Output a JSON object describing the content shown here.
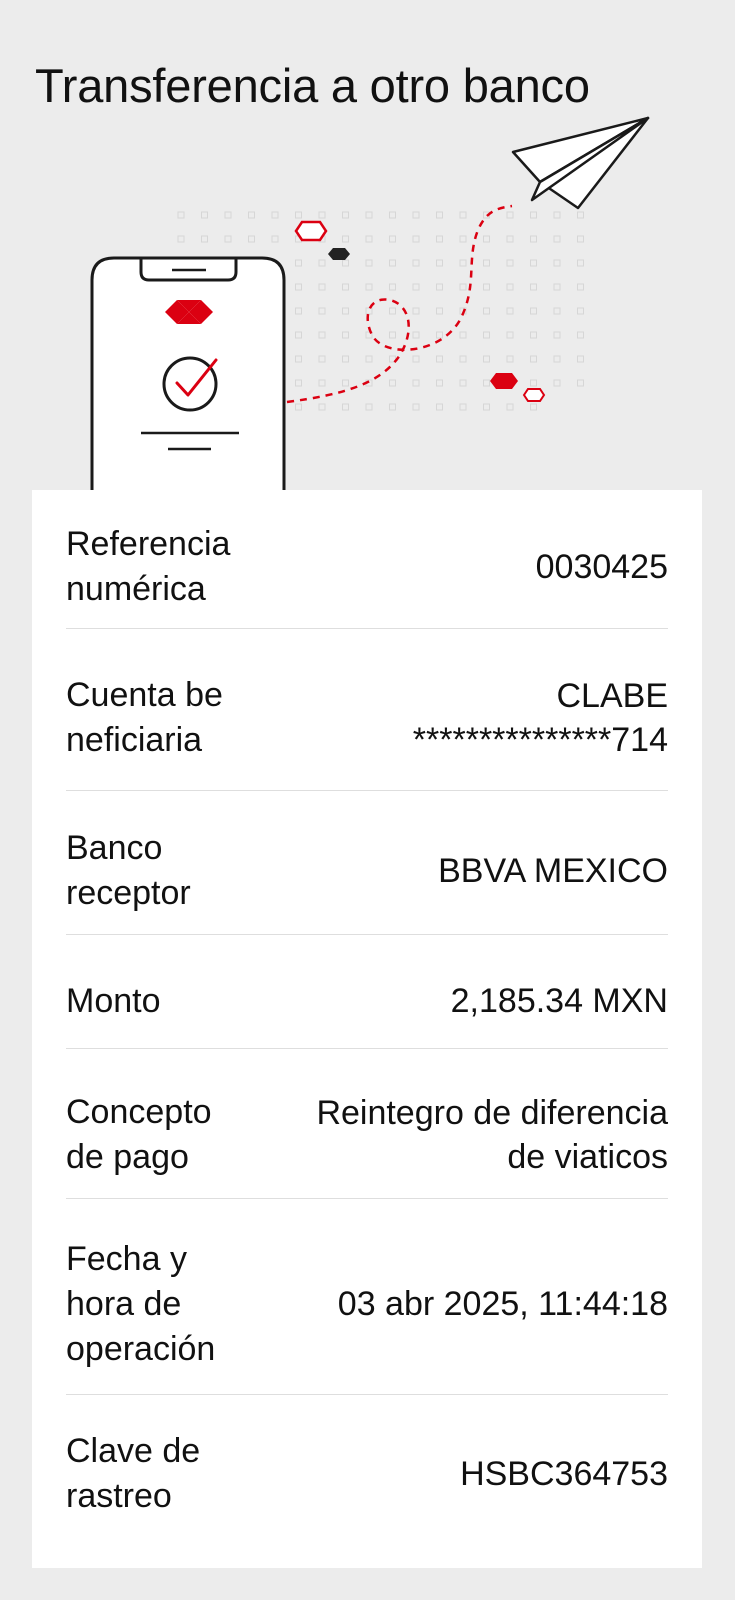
{
  "title": "Transferencia a otro banco",
  "icons": [
    "paper-plane-icon",
    "hsbc-logo-icon",
    "check-circle-icon"
  ],
  "colors": {
    "accent": "#db0011",
    "background": "#ececec",
    "card": "#ffffff",
    "text": "#111111"
  },
  "details": [
    {
      "label": "Referencia\nnumérica",
      "value": "0030425"
    },
    {
      "label": "Cuenta be\nneficiaria",
      "value": "CLABE\n***************714"
    },
    {
      "label": "Banco\nreceptor",
      "value": "BBVA MEXICO"
    },
    {
      "label": "Monto",
      "value": "2,185.34 MXN"
    },
    {
      "label": "Concepto\nde pago",
      "value": "Reintegro de diferencia\nde viaticos"
    },
    {
      "label": "Fecha y\nhora de\noperación",
      "value": "03 abr 2025, 11:44:18"
    },
    {
      "label": "Clave de\nrastreo",
      "value": "HSBC364753"
    }
  ]
}
